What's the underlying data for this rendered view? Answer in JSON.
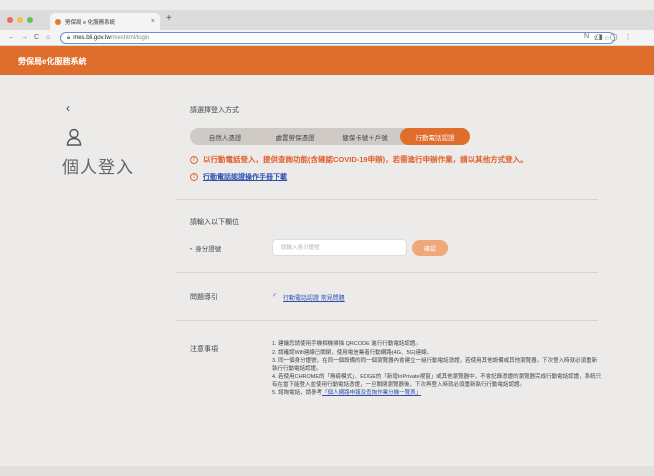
{
  "browser": {
    "tab_title": "勞保局 e 化服務系統",
    "tab_close": "×",
    "new_tab": "+",
    "nav": {
      "back": "←",
      "forward": "→",
      "reload": "C",
      "home": "⌂"
    },
    "url_host": "mes.bli.gov.tw",
    "url_path": "/meshtml/login",
    "omni_icons": [
      "⇪",
      "☆"
    ],
    "toolbar_icons": [
      "N",
      "◨",
      "◯",
      "⋮"
    ]
  },
  "site": {
    "title": "勞保局e化服務系統"
  },
  "login": {
    "back": "‹",
    "page_title": "個人登入",
    "method_label": "請選擇登入方式",
    "tabs": [
      {
        "label": "自然人憑證",
        "active": false
      },
      {
        "label": "處置勞保憑證",
        "active": false
      },
      {
        "label": "健保卡號＋戶號",
        "active": false
      },
      {
        "label": "行動電話認證",
        "active": true
      }
    ],
    "notice_icon": "!",
    "notice_text": "以行動電話登入，提供查詢功能(含確認COVID-19申辦)，若需進行申辦作業，請以其他方式登入。",
    "manual_link": "行動電話認證操作手冊下載",
    "input_section_label": "請輸入以下欄位",
    "required_mark": "•",
    "id_label": "身分證號",
    "id_placeholder": "請輸入身分證號",
    "id_value": "",
    "confirm_button": "確認",
    "qa_label": "問題導引",
    "qa_link_icon": "♂",
    "qa_link": "行動電話認證 常見問題",
    "notes_label": "注意事項",
    "notes": [
      {
        "text": "1. 建議您請使用手機相機掃描 QRCODE 進行行動電話認證。"
      },
      {
        "text": "2. 請確認Wifi連線已關閉，使用電信業者行動網路(4G、5G)連線。"
      },
      {
        "text": "3. 同一個身分證號，在同一個設備的同一個瀏覽器內會建立一組行動電話憑證，若使用其他設備或其他瀏覽器，下次登入時就必須重新執行行動電話認證。"
      },
      {
        "text": "4. 若使用CHROME的「無痕模式」、EDGE的「新增InPrivate視窗」或其他瀏覽器中，不會記錄憑證的瀏覽器完成行動電話認證，系統只有在當下能登入並使用行動電話憑證，一旦關閉瀏覽器後，下次再登入時就必須重新執行行動電話認證。"
      },
      {
        "text": "5. 諮詢電話，請參考",
        "link": "「個人網路申報及查詢作業分機一覽表」"
      }
    ]
  }
}
